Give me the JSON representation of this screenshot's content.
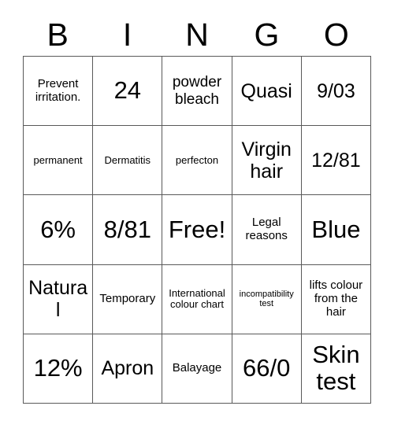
{
  "card": {
    "title": "BINGO Card",
    "header_letters": [
      "B",
      "I",
      "N",
      "G",
      "O"
    ],
    "grid_size": "5x5",
    "border_color": "#595959",
    "text_color": "#000000",
    "background_color": "#ffffff",
    "rows": [
      [
        {
          "text": "Prevent irritation.",
          "size": "fs-m"
        },
        {
          "text": "24",
          "size": "fs-xxl"
        },
        {
          "text": "powder bleach",
          "size": "fs-l"
        },
        {
          "text": "Quasi",
          "size": "fs-xl"
        },
        {
          "text": "9/03",
          "size": "fs-xl"
        }
      ],
      [
        {
          "text": "permanent",
          "size": "fs-s"
        },
        {
          "text": "Dermatitis",
          "size": "fs-s"
        },
        {
          "text": "perfecton",
          "size": "fs-s"
        },
        {
          "text": "Virgin hair",
          "size": "fs-xl"
        },
        {
          "text": "12/81",
          "size": "fs-xl"
        }
      ],
      [
        {
          "text": "6%",
          "size": "fs-xxl"
        },
        {
          "text": "8/81",
          "size": "fs-xxl"
        },
        {
          "text": "Free!",
          "size": "fs-xxl"
        },
        {
          "text": "Legal reasons",
          "size": "fs-m"
        },
        {
          "text": "Blue",
          "size": "fs-xxl"
        }
      ],
      [
        {
          "text": "Natural",
          "size": "fs-xl"
        },
        {
          "text": "Temporary",
          "size": "fs-m"
        },
        {
          "text": "International colour chart",
          "size": "fs-s"
        },
        {
          "text": "incompatibility test",
          "size": "fs-xs"
        },
        {
          "text": "lifts colour from the hair",
          "size": "fs-m"
        }
      ],
      [
        {
          "text": "12%",
          "size": "fs-xxl"
        },
        {
          "text": "Apron",
          "size": "fs-xl"
        },
        {
          "text": "Balayage",
          "size": "fs-m"
        },
        {
          "text": "66/0",
          "size": "fs-xxl"
        },
        {
          "text": "Skin test",
          "size": "fs-xxl"
        }
      ]
    ]
  }
}
